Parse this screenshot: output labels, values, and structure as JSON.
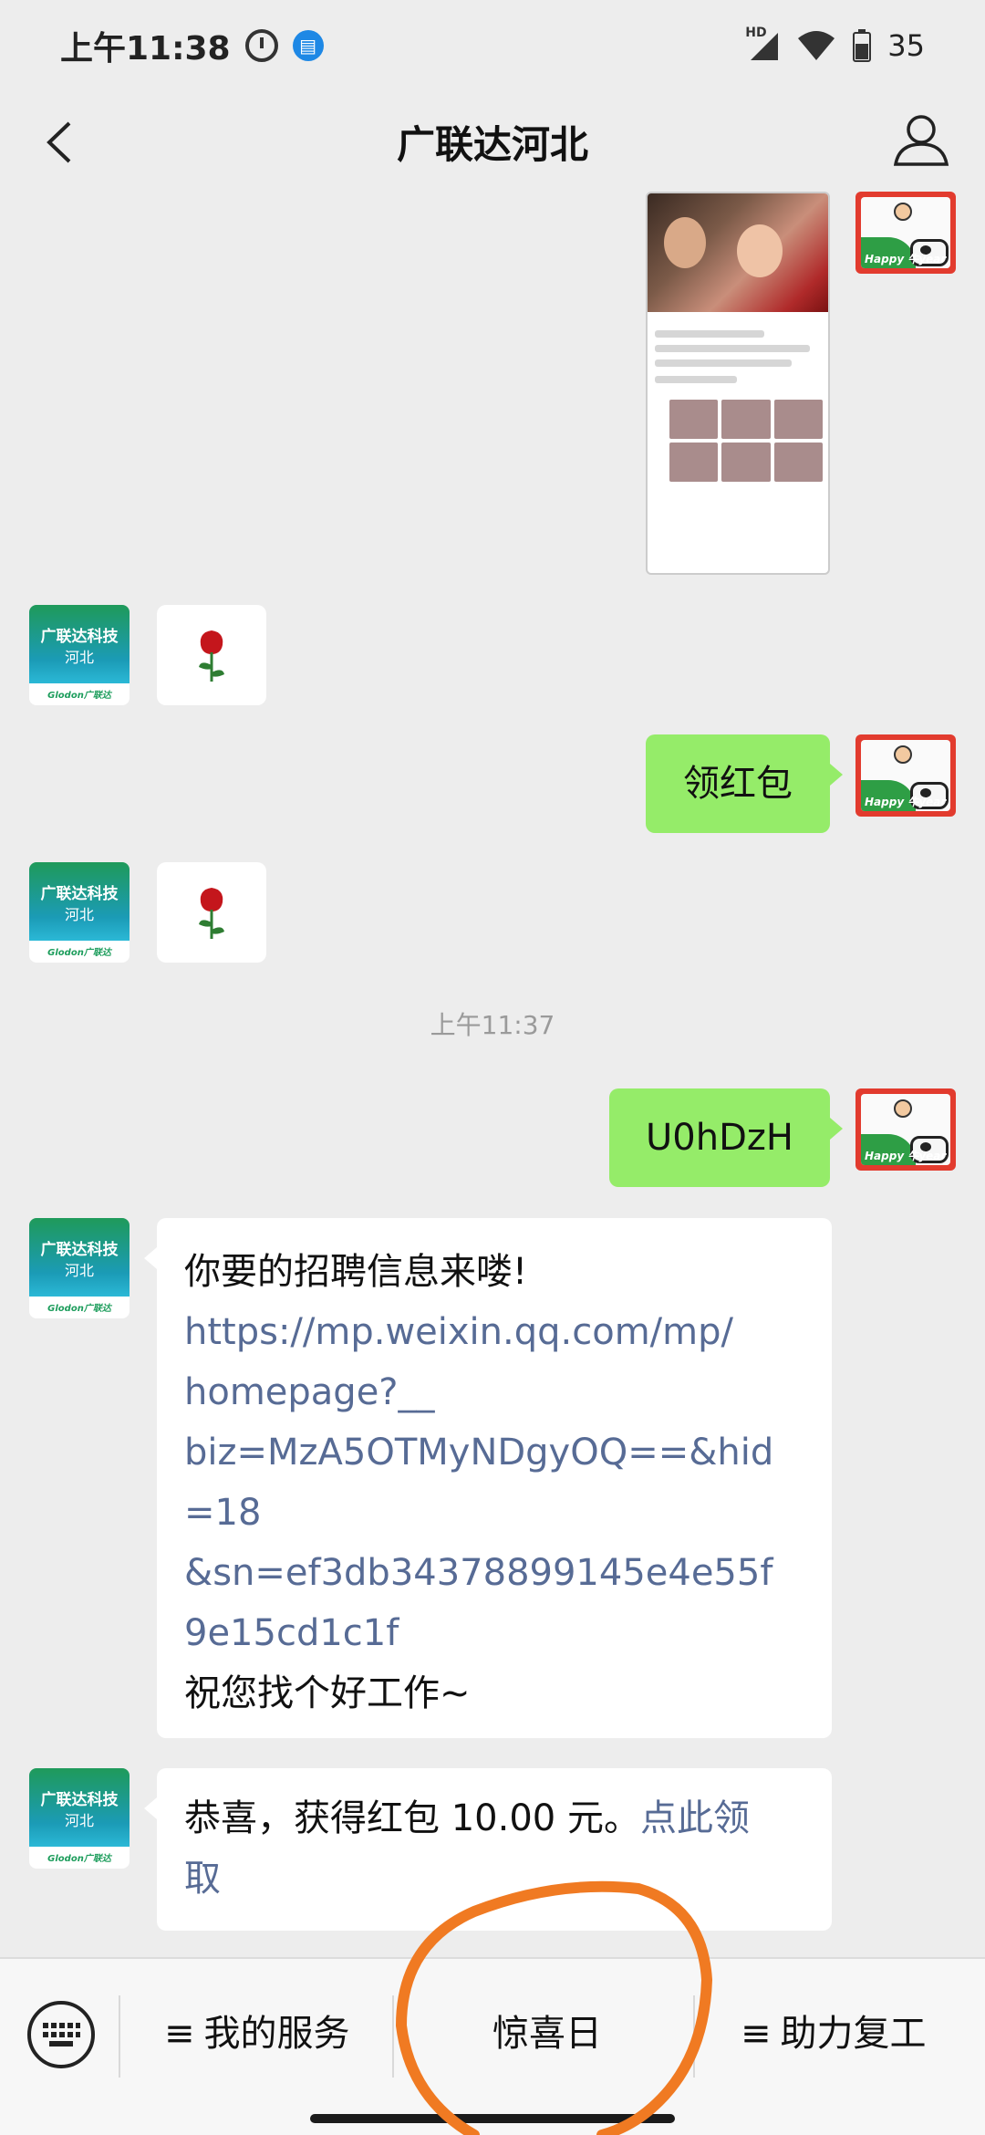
{
  "status_bar": {
    "time": "上午11:38",
    "signal_label": "HD",
    "battery": "35"
  },
  "header": {
    "title": "广联达河北"
  },
  "avatars": {
    "left_line1": "广联达科技",
    "left_line2": "河北",
    "left_brand": "Glodon广联达",
    "right_text": "Happy 牛year"
  },
  "messages": {
    "m1_text": "领红包",
    "timestamp": "上午11:37",
    "m2_text": "U0hDzH",
    "m3_line1": "你要的招聘信息来喽!",
    "m3_link_lines": [
      "https://mp.weixin.qq.com/mp/",
      "homepage?__",
      "biz=MzA5OTMyNDgyOQ==&hid",
      "=18",
      "&sn=ef3db34378899145e4e55f",
      "9e15cd1c1f"
    ],
    "m3_line_last": "祝您找个好工作~",
    "m4_text": "恭喜，获得红包 10.00 元。",
    "m4_link_a": "点此领",
    "m4_link_b": "取"
  },
  "bottom_menu": {
    "item1": "我的服务",
    "item2": "惊喜日",
    "item3": "助力复工"
  },
  "colors": {
    "bubble_green": "#95ec69",
    "link": "#576b95",
    "annotation": "#f07a22"
  }
}
